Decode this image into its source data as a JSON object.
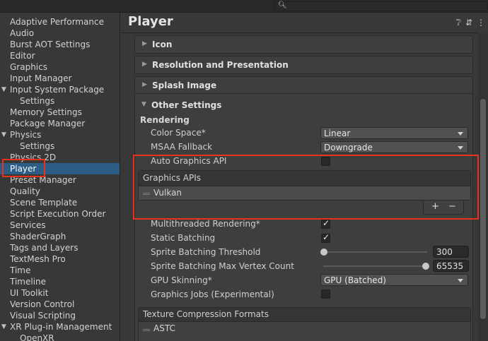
{
  "search": {
    "placeholder": ""
  },
  "sidebar": {
    "items": [
      {
        "label": "Adaptive Performance"
      },
      {
        "label": "Audio"
      },
      {
        "label": "Burst AOT Settings"
      },
      {
        "label": "Editor"
      },
      {
        "label": "Graphics"
      },
      {
        "label": "Input Manager"
      },
      {
        "label": "Input System Package"
      },
      {
        "label": "Settings"
      },
      {
        "label": "Memory Settings"
      },
      {
        "label": "Package Manager"
      },
      {
        "label": "Physics"
      },
      {
        "label": "Settings"
      },
      {
        "label": "Physics 2D"
      },
      {
        "label": "Player"
      },
      {
        "label": "Preset Manager"
      },
      {
        "label": "Quality"
      },
      {
        "label": "Scene Template"
      },
      {
        "label": "Script Execution Order"
      },
      {
        "label": "Services"
      },
      {
        "label": "ShaderGraph"
      },
      {
        "label": "Tags and Layers"
      },
      {
        "label": "TextMesh Pro"
      },
      {
        "label": "Time"
      },
      {
        "label": "Timeline"
      },
      {
        "label": "UI Toolkit"
      },
      {
        "label": "Version Control"
      },
      {
        "label": "Visual Scripting"
      },
      {
        "label": "XR Plug-in Management"
      },
      {
        "label": "OpenXR"
      }
    ],
    "selected": "Player"
  },
  "main": {
    "title": "Player",
    "sections": {
      "icon": "Icon",
      "resolution": "Resolution and Presentation",
      "splash": "Splash Image",
      "other": "Other Settings"
    },
    "rendering": {
      "heading": "Rendering",
      "color_space_label": "Color Space*",
      "color_space_value": "Linear",
      "msaa_label": "MSAA Fallback",
      "msaa_value": "Downgrade",
      "auto_graphics_label": "Auto Graphics API",
      "auto_graphics_checked": false,
      "graphics_apis_header": "Graphics APIs",
      "graphics_apis_items": [
        "Vulkan"
      ],
      "add_symbol": "+",
      "remove_symbol": "−",
      "multithreaded_label": "Multithreaded Rendering*",
      "multithreaded_checked": true,
      "static_batching_label": "Static Batching",
      "static_batching_checked": true,
      "sprite_threshold_label": "Sprite Batching Threshold",
      "sprite_threshold_value": "300",
      "sprite_max_vertex_label": "Sprite Batching Max Vertex Count",
      "sprite_max_vertex_value": "65535",
      "gpu_skinning_label": "GPU Skinning*",
      "gpu_skinning_value": "GPU (Batched)",
      "graphics_jobs_label": "Graphics Jobs (Experimental)",
      "graphics_jobs_checked": false,
      "texture_compression_header": "Texture Compression Formats",
      "texture_compression_items": [
        "ASTC"
      ]
    }
  },
  "colors": {
    "selection": "#2c5d87",
    "highlight": "#e8321e"
  }
}
